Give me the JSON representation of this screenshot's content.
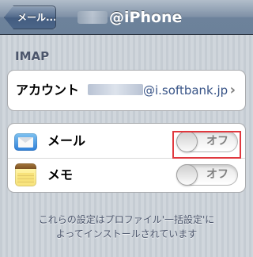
{
  "nav": {
    "back_label": "メール...",
    "title_suffix": "@iPhone"
  },
  "section": {
    "header": "IMAP"
  },
  "account": {
    "label": "アカウント",
    "value_suffix": "@i.softbank.jp",
    "chevron": "›"
  },
  "settings": [
    {
      "label": "メール",
      "icon": "mail-icon",
      "toggle_label": "オフ",
      "on": false
    },
    {
      "label": "メモ",
      "icon": "notes-icon",
      "toggle_label": "オフ",
      "on": false
    }
  ],
  "footer": {
    "line1": "これらの設定はプロファイル'一括設定'に",
    "line2": "よってインストールされています"
  },
  "colors": {
    "highlight": "#e0383e",
    "link_blue": "#385487",
    "section_text": "#4c566c"
  }
}
